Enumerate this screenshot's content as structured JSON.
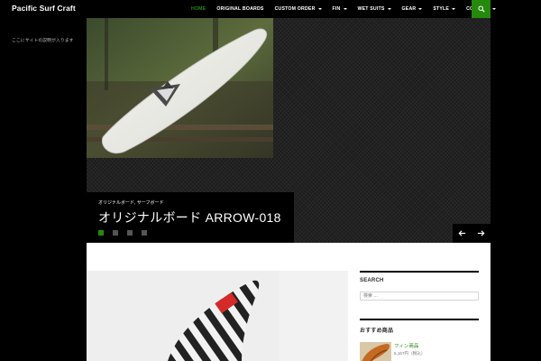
{
  "header": {
    "site_title": "Pacific Surf Craft",
    "site_description": "ここにサイトの説明が入ります",
    "nav": [
      {
        "label": "HOME",
        "active": true,
        "dropdown": false
      },
      {
        "label": "ORIGINAL BOARDS",
        "active": false,
        "dropdown": false
      },
      {
        "label": "CUSTOM ORDER",
        "active": false,
        "dropdown": true
      },
      {
        "label": "FIN",
        "active": false,
        "dropdown": true
      },
      {
        "label": "WET SUITS",
        "active": false,
        "dropdown": true
      },
      {
        "label": "GEAR",
        "active": false,
        "dropdown": true
      },
      {
        "label": "STYLE",
        "active": false,
        "dropdown": true
      },
      {
        "label": "CONTACT",
        "active": false,
        "dropdown": true
      }
    ],
    "search_icon": "search-icon"
  },
  "slider": {
    "categories": "オリジナルボード, サーフボード",
    "title": "オリジナルボード ARROW-018",
    "dot_count": 4,
    "active_dot": 0,
    "prev_icon": "arrow-left-icon",
    "next_icon": "arrow-right-icon"
  },
  "sidebar": {
    "search_title": "SEARCH",
    "search_placeholder": "検索 …",
    "widget2_title": "おすすめ商品",
    "recent_title": "フィン商品",
    "recent_price": "5,167円（税込）"
  },
  "colors": {
    "accent": "#24890d",
    "background": "#000000",
    "content_bg": "#ffffff"
  }
}
